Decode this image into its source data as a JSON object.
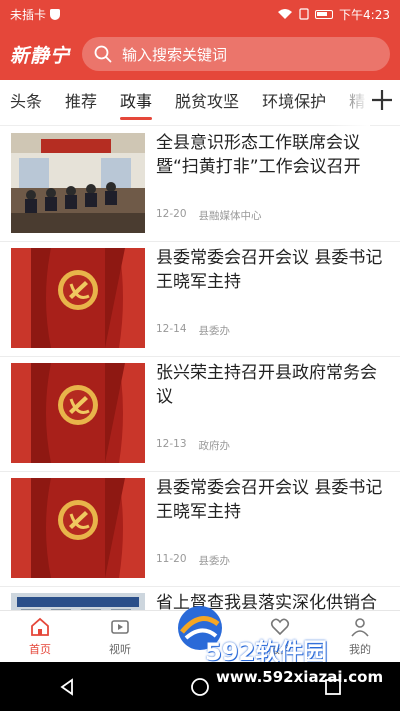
{
  "status": {
    "carrier": "未插卡",
    "time": "下午4:23"
  },
  "header": {
    "logo": "新静宁",
    "search_placeholder": "输入搜索关键词"
  },
  "tabs": [
    "头条",
    "推荐",
    "政事",
    "脱贫攻坚",
    "环境保护",
    "精"
  ],
  "active_tab": "政事",
  "news": [
    {
      "title": "全县意识形态工作联席会议暨“扫黄打非”工作会议召开",
      "date": "12-20",
      "source": "县融媒体中心",
      "image": "meeting-photo"
    },
    {
      "title": "县委常委会召开会议 县委书记王晓军主持",
      "date": "12-14",
      "source": "县委办",
      "image": "party-emblem"
    },
    {
      "title": "张兴荣主持召开县政府常务会议",
      "date": "12-13",
      "source": "政府办",
      "image": "party-emblem"
    },
    {
      "title": "县委常委会召开会议 县委书记王晓军主持",
      "date": "11-20",
      "source": "县委办",
      "image": "party-emblem"
    },
    {
      "title": "省上督查我县落实深化供销合",
      "date": "",
      "source": "",
      "image": "building-photo"
    }
  ],
  "bottom_nav": [
    {
      "label": "首页",
      "icon": "home-icon",
      "active": true
    },
    {
      "label": "视听",
      "icon": "tv-icon",
      "active": false
    },
    {
      "label": "",
      "icon": "center-logo-icon",
      "active": false
    },
    {
      "label": "服务",
      "icon": "heart-icon",
      "active": false
    },
    {
      "label": "我的",
      "icon": "user-icon",
      "active": false
    }
  ],
  "watermark": {
    "text": "592软件园",
    "url": "www.592xiazai.com"
  },
  "colors": {
    "brand": "#e5473a",
    "meta": "#999999"
  }
}
